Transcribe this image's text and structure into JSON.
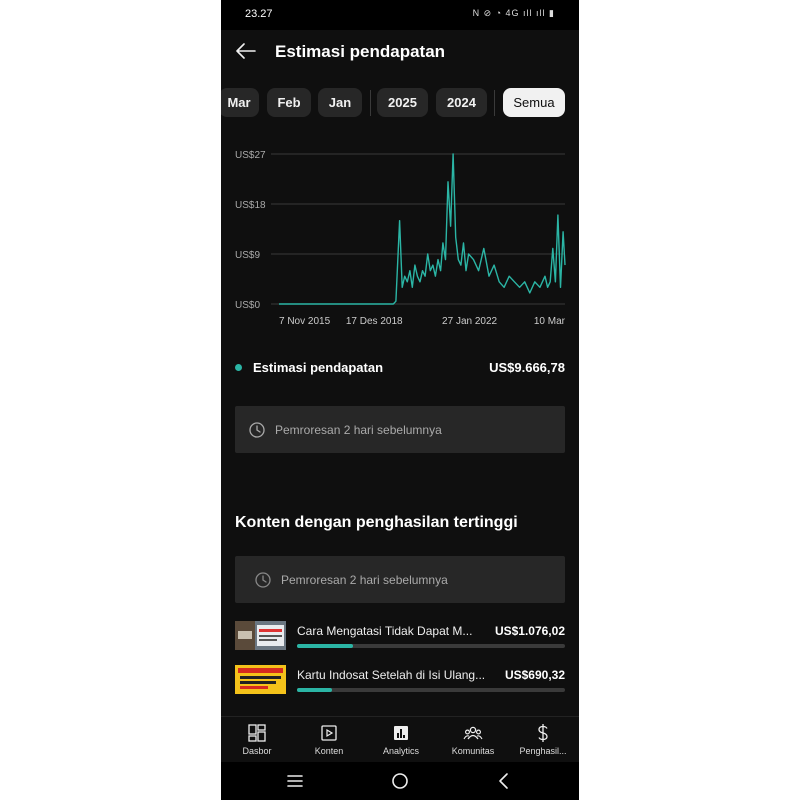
{
  "status": {
    "time": "23.27",
    "icons_text": "N ⊘ ◔ 4G ıll ıll ▮"
  },
  "header": {
    "title": "Estimasi pendapatan"
  },
  "chips": [
    {
      "label": "Mar",
      "selected": false
    },
    {
      "label": "Feb",
      "selected": false
    },
    {
      "label": "Jan",
      "selected": false
    },
    {
      "label": "2025",
      "selected": false
    },
    {
      "label": "2024",
      "selected": false
    },
    {
      "label": "Semua",
      "selected": true
    }
  ],
  "chart_data": {
    "type": "line",
    "title": "",
    "xlabel": "",
    "ylabel": "",
    "y_tick_labels": [
      "US$0",
      "US$9",
      "US$18",
      "US$27"
    ],
    "y_ticks": [
      0,
      9,
      18,
      27
    ],
    "ylim": [
      0,
      27
    ],
    "x_tick_labels": [
      "7 Nov 2015",
      "17 Des 2018",
      "27 Jan 2022",
      "10 Mar"
    ],
    "x_tick_dates": [
      "2015-11-07",
      "2018-12-17",
      "2022-01-27",
      "2025-03-10"
    ],
    "grid": true,
    "color": "#2bb5a5",
    "series": [
      {
        "x": [
          "2015-11-07",
          "2016-06-01",
          "2017-01-01",
          "2017-08-01",
          "2018-03-01",
          "2018-10-01",
          "2019-05-01",
          "2019-08-01",
          "2019-09-01",
          "2019-10-15",
          "2019-11-15",
          "2019-12-15",
          "2020-01-15",
          "2020-02-15",
          "2020-03-15",
          "2020-04-15",
          "2020-05-15",
          "2020-06-15",
          "2020-07-15",
          "2020-08-15",
          "2020-09-15",
          "2020-10-15",
          "2020-11-15",
          "2020-12-15",
          "2021-01-15",
          "2021-02-15",
          "2021-03-15",
          "2021-04-15",
          "2021-05-15",
          "2021-06-15",
          "2021-07-15",
          "2021-08-15",
          "2021-09-15",
          "2021-10-15",
          "2021-11-15",
          "2021-12-15",
          "2022-01-15",
          "2022-03-15",
          "2022-05-15",
          "2022-07-15",
          "2022-09-15",
          "2022-11-15",
          "2023-01-15",
          "2023-03-15",
          "2023-05-15",
          "2023-07-15",
          "2023-09-15",
          "2023-11-15",
          "2024-01-15",
          "2024-03-15",
          "2024-05-15",
          "2024-07-15",
          "2024-08-15",
          "2024-09-15",
          "2024-10-15",
          "2024-11-15",
          "2024-12-15",
          "2025-01-15",
          "2025-02-15",
          "2025-03-10"
        ],
        "y": [
          0,
          0,
          0,
          0,
          0,
          0,
          0,
          0,
          0.5,
          15,
          3,
          5,
          4,
          6,
          3,
          7,
          5,
          4,
          6,
          5,
          9,
          6,
          7,
          5,
          8,
          6,
          11,
          8,
          22,
          14,
          27,
          12,
          8,
          7,
          11,
          6,
          9,
          8,
          6,
          10,
          5,
          7,
          4,
          3,
          5,
          4,
          3,
          4,
          2,
          4,
          3,
          5,
          3,
          4,
          10,
          4,
          16,
          3,
          13,
          7
        ]
      }
    ]
  },
  "legend": {
    "label": "Estimasi pendapatan",
    "value": "US$9.666,78"
  },
  "processing": {
    "text": "Pemroresan 2 hari sebelumnya"
  },
  "top_content": {
    "title": "Konten dengan penghasilan tertinggi",
    "processing_text": "Pemroresan 2 hari sebelumnya",
    "items": [
      {
        "title": "Cara Mengatasi Tidak Dapat M...",
        "value": "US$1.076,02",
        "share": 0.21
      },
      {
        "title": "Kartu Indosat Setelah di Isi Ulang...",
        "value": "US$690,32",
        "share": 0.13
      }
    ]
  },
  "bottom_nav": [
    {
      "label": "Dasbor",
      "icon": "dashboard-icon"
    },
    {
      "label": "Konten",
      "icon": "content-icon"
    },
    {
      "label": "Analytics",
      "icon": "analytics-icon"
    },
    {
      "label": "Komunitas",
      "icon": "community-icon"
    },
    {
      "label": "Penghasil...",
      "icon": "earn-icon"
    }
  ]
}
